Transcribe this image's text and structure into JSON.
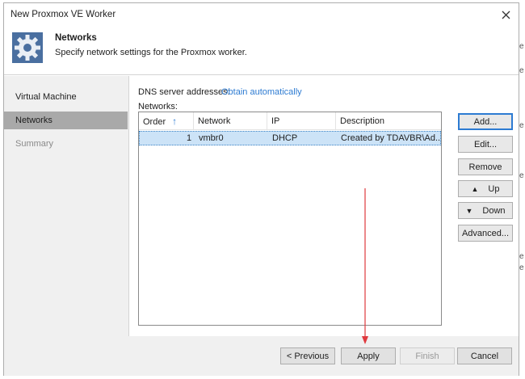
{
  "window": {
    "title": "New Proxmox VE Worker"
  },
  "header": {
    "title": "Networks",
    "subtitle": "Specify network settings for the Proxmox worker."
  },
  "sidebar": {
    "items": [
      {
        "label": "Virtual Machine",
        "state": "normal"
      },
      {
        "label": "Networks",
        "state": "active"
      },
      {
        "label": "Summary",
        "state": "disabled"
      }
    ]
  },
  "dns": {
    "label": "DNS server addresses:",
    "value": "Obtain automatically"
  },
  "networks": {
    "label": "Networks:",
    "columns": [
      "Order",
      "Network",
      "IP",
      "Description"
    ],
    "sort_icon": "↑",
    "rows": [
      {
        "order": "1",
        "network": "vmbr0",
        "ip": "DHCP",
        "description": "Created by TDAVBR\\Ad..."
      }
    ]
  },
  "actions": {
    "add": "Add...",
    "edit": "Edit...",
    "remove": "Remove",
    "up": "Up",
    "down": "Down",
    "advanced": "Advanced..."
  },
  "footer": {
    "previous": "< Previous",
    "apply": "Apply",
    "finish": "Finish",
    "cancel": "Cancel"
  },
  "background_fragments": [
    "e",
    "e",
    "e",
    "e",
    "e",
    "e"
  ],
  "colors": {
    "link": "#2d7bd2",
    "selection": "#cce3f7",
    "annotation_arrow": "#e0393e"
  }
}
